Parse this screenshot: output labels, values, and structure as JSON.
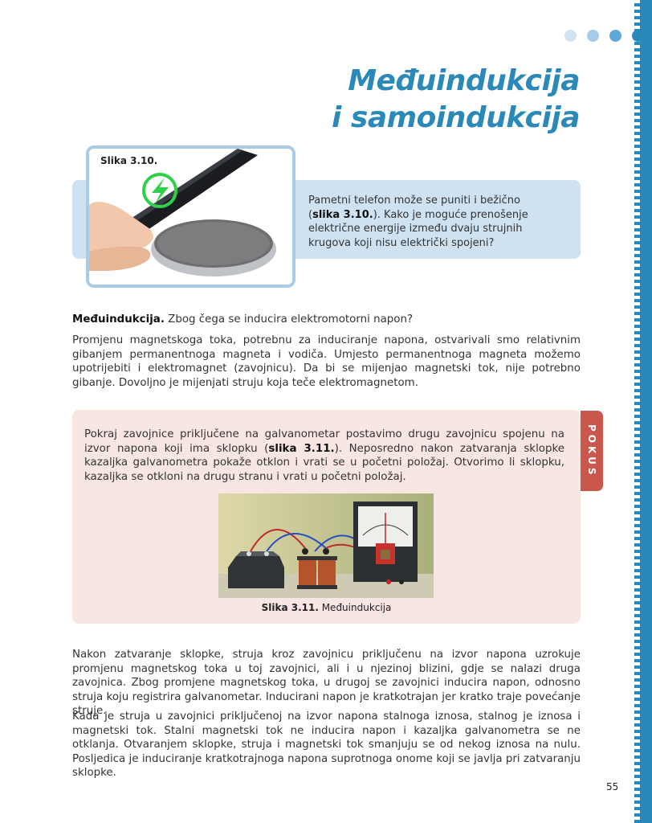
{
  "header": {
    "title_line1": "Međuindukcija",
    "title_line2": "i samoindukcija",
    "dot_colors": [
      "#cfe3f3",
      "#a4cbe9",
      "#5fa8d8",
      "#2a89b8"
    ]
  },
  "intro": {
    "figure_label": "Slika 3.10.",
    "text_before": "Pametni telefon može se puniti i bežično (",
    "figure_ref": "slika 3.10.",
    "text_after": "). Kako je moguće prenošenje električne energije između dvaju strujnih krugova koji nisu električki spojeni?"
  },
  "section": {
    "heading": "Međuindukcija.",
    "question": " Zbog čega se inducira elektromotorni napon?",
    "paragraph1": "Promjenu magnetskoga toka, potrebnu za induciranje napona, ostvarivali smo relativnim gibanjem permanentnoga magneta i vodiča. Umjesto permanentnoga magneta možemo upotrijebiti i elektromagnet (zavojnicu). Da bi se mijenjao magnetski tok, nije potrebno gibanje. Dovoljno je mijenjati struju koja teče elektromagnetom."
  },
  "experiment": {
    "tab_label": "POKUS",
    "text_before": "Pokraj zavojnice priključene na galvanometar postavimo drugu zavojnicu spojenu na izvor napona koji ima sklopku (",
    "figure_ref": "slika 3.11.",
    "text_after": "). Neposredno nakon zatvaranja sklopke kazaljka galvanometra pokaže otklon i vrati se u početni položaj. Otvorimo li sklopku, kazaljka se otkloni na drugu stranu i vrati u početni položaj.",
    "caption_label": "Slika 3.11.",
    "caption_text": " Međuindukcija"
  },
  "conclusion": {
    "paragraph1": "Nakon zatvaranje sklopke, struja kroz zavojnicu priključenu na izvor napona uzrokuje promjenu magnetskog toka u toj zavojnici, ali i u njezinoj blizini, gdje se nalazi druga zavojnica. Zbog promjene magnetskog toka, u drugoj se zavojnici inducira napon, odnosno struja koju registrira galvanometar. Inducirani napon je kratkotrajan jer kratko traje povećanje struje.",
    "paragraph2": "Kada je struja u zavojnici priključenoj na izvor napona stalnoga iznosa, stalnog je iznosa i magnetski tok. Stalni magnetski tok ne inducira napon i kazaljka galvanometra se ne otklanja. Otvaranjem sklopke, struja i magnetski tok smanjuju se od nekog iznosa na nulu. Posljedica je induciranje kratkotrajnoga napona suprotnoga onome koji se javlja pri zatvaranju sklopke."
  },
  "footer": {
    "page_number": "55"
  }
}
